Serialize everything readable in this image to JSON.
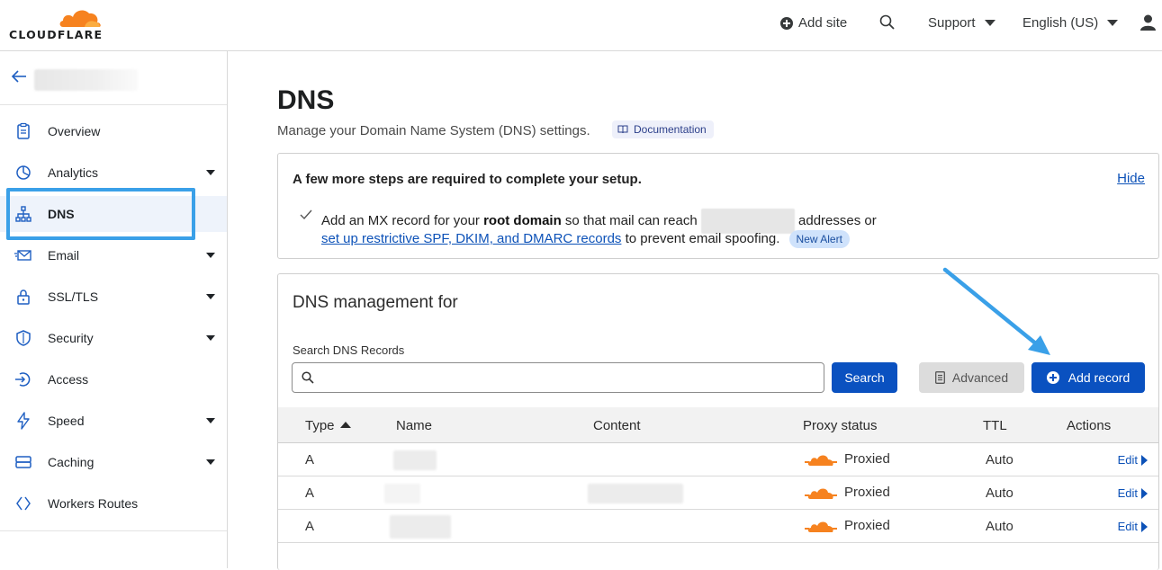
{
  "brand": {
    "name": "CLOUDFLARE"
  },
  "topbar": {
    "add_site": "Add site",
    "support": "Support",
    "language": "English (US)"
  },
  "sidebar": {
    "items": [
      {
        "label": "Overview",
        "icon": "clipboard-icon",
        "dropdown": false
      },
      {
        "label": "Analytics",
        "icon": "pie-chart-icon",
        "dropdown": true
      },
      {
        "label": "DNS",
        "icon": "network-icon",
        "dropdown": false,
        "active": true
      },
      {
        "label": "Email",
        "icon": "email-icon",
        "dropdown": true
      },
      {
        "label": "SSL/TLS",
        "icon": "lock-icon",
        "dropdown": true
      },
      {
        "label": "Security",
        "icon": "shield-icon",
        "dropdown": true
      },
      {
        "label": "Access",
        "icon": "access-icon",
        "dropdown": false
      },
      {
        "label": "Speed",
        "icon": "lightning-icon",
        "dropdown": true
      },
      {
        "label": "Caching",
        "icon": "storage-icon",
        "dropdown": true
      },
      {
        "label": "Workers Routes",
        "icon": "workers-icon",
        "dropdown": false
      }
    ]
  },
  "main": {
    "title": "DNS",
    "subtitle": "Manage your Domain Name System (DNS) settings.",
    "documentation": "Documentation",
    "setup": {
      "title": "A few more steps are required to complete your setup.",
      "hide": "Hide",
      "line1_pre": "Add an MX record for your ",
      "line1_bold": "root domain",
      "line1_mid": " so that mail can reach ",
      "line1_post": " addresses or",
      "line2_link": "set up restrictive SPF, DKIM, and DMARC records",
      "line2_post": " to prevent email spoofing.",
      "alert_badge": "New Alert"
    },
    "management": {
      "title": "DNS management for",
      "search_label": "Search DNS Records",
      "search_placeholder": "",
      "search_button": "Search",
      "advanced_button": "Advanced",
      "add_button": "Add record"
    },
    "table": {
      "headers": {
        "type": "Type",
        "name": "Name",
        "content": "Content",
        "proxy": "Proxy status",
        "ttl": "TTL",
        "actions": "Actions"
      },
      "rows": [
        {
          "type": "A",
          "proxy": "Proxied",
          "ttl": "Auto",
          "action": "Edit"
        },
        {
          "type": "A",
          "proxy": "Proxied",
          "ttl": "Auto",
          "action": "Edit"
        },
        {
          "type": "A",
          "proxy": "Proxied",
          "ttl": "Auto",
          "action": "Edit"
        }
      ]
    }
  },
  "colors": {
    "brand_orange": "#f6821f",
    "primary_blue": "#0a51c0",
    "link_blue": "#0d52b8",
    "annotation_blue": "#3aa0e8"
  }
}
